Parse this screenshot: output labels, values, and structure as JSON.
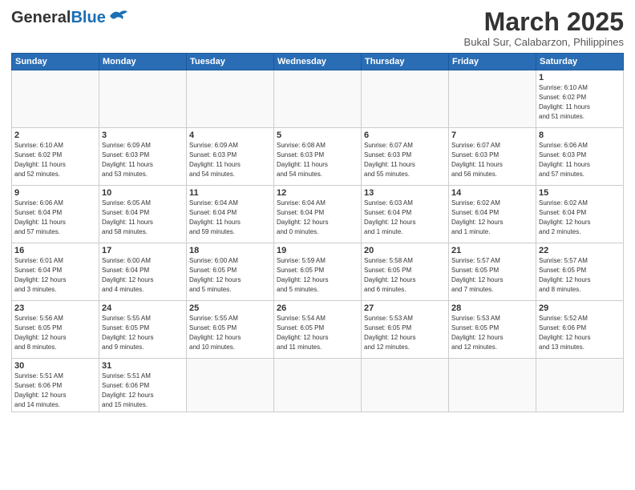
{
  "header": {
    "logo_general": "General",
    "logo_blue": "Blue",
    "title": "March 2025",
    "subtitle": "Bukal Sur, Calabarzon, Philippines"
  },
  "weekdays": [
    "Sunday",
    "Monday",
    "Tuesday",
    "Wednesday",
    "Thursday",
    "Friday",
    "Saturday"
  ],
  "weeks": [
    [
      {
        "day": "",
        "info": ""
      },
      {
        "day": "",
        "info": ""
      },
      {
        "day": "",
        "info": ""
      },
      {
        "day": "",
        "info": ""
      },
      {
        "day": "",
        "info": ""
      },
      {
        "day": "",
        "info": ""
      },
      {
        "day": "1",
        "info": "Sunrise: 6:10 AM\nSunset: 6:02 PM\nDaylight: 11 hours\nand 51 minutes."
      }
    ],
    [
      {
        "day": "2",
        "info": "Sunrise: 6:10 AM\nSunset: 6:02 PM\nDaylight: 11 hours\nand 52 minutes."
      },
      {
        "day": "3",
        "info": "Sunrise: 6:09 AM\nSunset: 6:03 PM\nDaylight: 11 hours\nand 53 minutes."
      },
      {
        "day": "4",
        "info": "Sunrise: 6:09 AM\nSunset: 6:03 PM\nDaylight: 11 hours\nand 54 minutes."
      },
      {
        "day": "5",
        "info": "Sunrise: 6:08 AM\nSunset: 6:03 PM\nDaylight: 11 hours\nand 54 minutes."
      },
      {
        "day": "6",
        "info": "Sunrise: 6:07 AM\nSunset: 6:03 PM\nDaylight: 11 hours\nand 55 minutes."
      },
      {
        "day": "7",
        "info": "Sunrise: 6:07 AM\nSunset: 6:03 PM\nDaylight: 11 hours\nand 56 minutes."
      },
      {
        "day": "8",
        "info": "Sunrise: 6:06 AM\nSunset: 6:03 PM\nDaylight: 11 hours\nand 57 minutes."
      }
    ],
    [
      {
        "day": "9",
        "info": "Sunrise: 6:06 AM\nSunset: 6:04 PM\nDaylight: 11 hours\nand 57 minutes."
      },
      {
        "day": "10",
        "info": "Sunrise: 6:05 AM\nSunset: 6:04 PM\nDaylight: 11 hours\nand 58 minutes."
      },
      {
        "day": "11",
        "info": "Sunrise: 6:04 AM\nSunset: 6:04 PM\nDaylight: 11 hours\nand 59 minutes."
      },
      {
        "day": "12",
        "info": "Sunrise: 6:04 AM\nSunset: 6:04 PM\nDaylight: 12 hours\nand 0 minutes."
      },
      {
        "day": "13",
        "info": "Sunrise: 6:03 AM\nSunset: 6:04 PM\nDaylight: 12 hours\nand 1 minute."
      },
      {
        "day": "14",
        "info": "Sunrise: 6:02 AM\nSunset: 6:04 PM\nDaylight: 12 hours\nand 1 minute."
      },
      {
        "day": "15",
        "info": "Sunrise: 6:02 AM\nSunset: 6:04 PM\nDaylight: 12 hours\nand 2 minutes."
      }
    ],
    [
      {
        "day": "16",
        "info": "Sunrise: 6:01 AM\nSunset: 6:04 PM\nDaylight: 12 hours\nand 3 minutes."
      },
      {
        "day": "17",
        "info": "Sunrise: 6:00 AM\nSunset: 6:04 PM\nDaylight: 12 hours\nand 4 minutes."
      },
      {
        "day": "18",
        "info": "Sunrise: 6:00 AM\nSunset: 6:05 PM\nDaylight: 12 hours\nand 5 minutes."
      },
      {
        "day": "19",
        "info": "Sunrise: 5:59 AM\nSunset: 6:05 PM\nDaylight: 12 hours\nand 5 minutes."
      },
      {
        "day": "20",
        "info": "Sunrise: 5:58 AM\nSunset: 6:05 PM\nDaylight: 12 hours\nand 6 minutes."
      },
      {
        "day": "21",
        "info": "Sunrise: 5:57 AM\nSunset: 6:05 PM\nDaylight: 12 hours\nand 7 minutes."
      },
      {
        "day": "22",
        "info": "Sunrise: 5:57 AM\nSunset: 6:05 PM\nDaylight: 12 hours\nand 8 minutes."
      }
    ],
    [
      {
        "day": "23",
        "info": "Sunrise: 5:56 AM\nSunset: 6:05 PM\nDaylight: 12 hours\nand 8 minutes."
      },
      {
        "day": "24",
        "info": "Sunrise: 5:55 AM\nSunset: 6:05 PM\nDaylight: 12 hours\nand 9 minutes."
      },
      {
        "day": "25",
        "info": "Sunrise: 5:55 AM\nSunset: 6:05 PM\nDaylight: 12 hours\nand 10 minutes."
      },
      {
        "day": "26",
        "info": "Sunrise: 5:54 AM\nSunset: 6:05 PM\nDaylight: 12 hours\nand 11 minutes."
      },
      {
        "day": "27",
        "info": "Sunrise: 5:53 AM\nSunset: 6:05 PM\nDaylight: 12 hours\nand 12 minutes."
      },
      {
        "day": "28",
        "info": "Sunrise: 5:53 AM\nSunset: 6:05 PM\nDaylight: 12 hours\nand 12 minutes."
      },
      {
        "day": "29",
        "info": "Sunrise: 5:52 AM\nSunset: 6:06 PM\nDaylight: 12 hours\nand 13 minutes."
      }
    ],
    [
      {
        "day": "30",
        "info": "Sunrise: 5:51 AM\nSunset: 6:06 PM\nDaylight: 12 hours\nand 14 minutes."
      },
      {
        "day": "31",
        "info": "Sunrise: 5:51 AM\nSunset: 6:06 PM\nDaylight: 12 hours\nand 15 minutes."
      },
      {
        "day": "",
        "info": ""
      },
      {
        "day": "",
        "info": ""
      },
      {
        "day": "",
        "info": ""
      },
      {
        "day": "",
        "info": ""
      },
      {
        "day": "",
        "info": ""
      }
    ]
  ]
}
